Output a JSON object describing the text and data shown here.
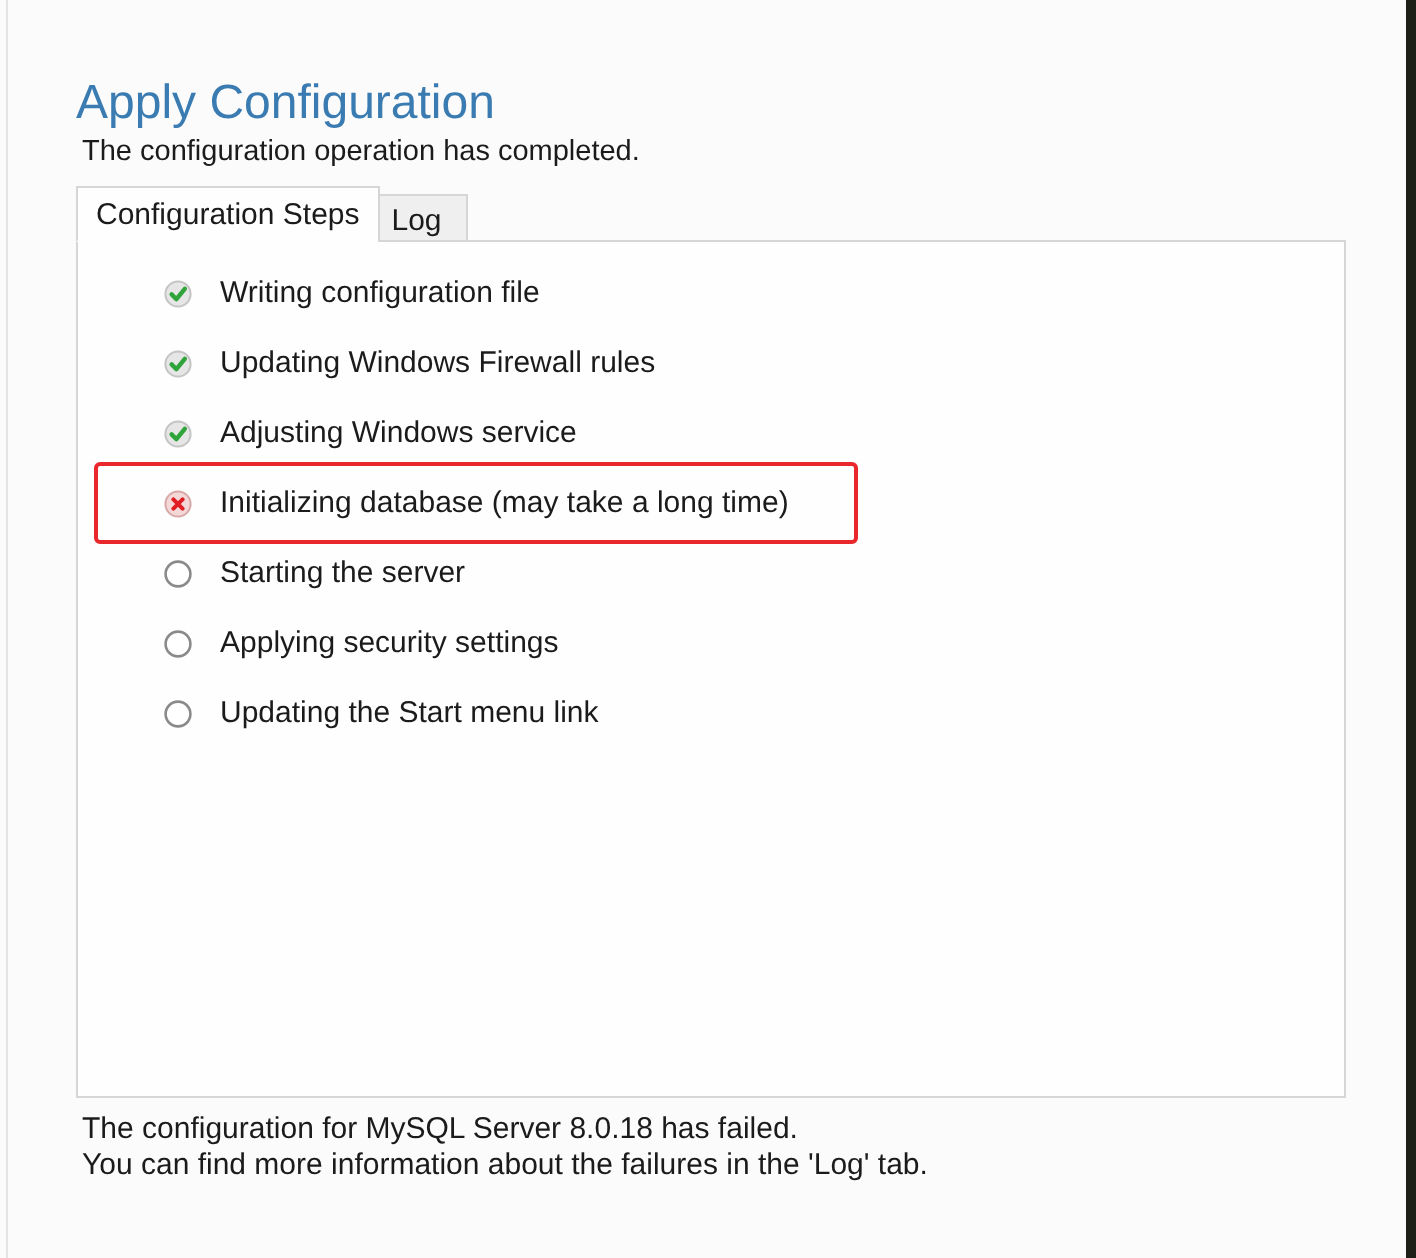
{
  "header": {
    "title": "Apply Configuration",
    "subtitle": "The configuration operation has completed."
  },
  "tabs": [
    {
      "label": "Configuration Steps",
      "selected": true
    },
    {
      "label": "Log",
      "selected": false
    }
  ],
  "steps": [
    {
      "label": "Writing configuration file",
      "kind": "done",
      "highlighted": false
    },
    {
      "label": "Updating Windows Firewall rules",
      "kind": "done",
      "highlighted": false
    },
    {
      "label": "Adjusting Windows service",
      "kind": "done",
      "highlighted": false
    },
    {
      "label": "Initializing database (may take a long time)",
      "kind": "failed",
      "highlighted": true
    },
    {
      "label": "Starting the server",
      "kind": "pending",
      "highlighted": false
    },
    {
      "label": "Applying security settings",
      "kind": "pending",
      "highlighted": false
    },
    {
      "label": "Updating the Start menu link",
      "kind": "pending",
      "highlighted": false
    }
  ],
  "footer": {
    "lines": [
      "The configuration for MySQL Server 8.0.18 has failed.",
      "You can find more information about the failures in the 'Log' tab."
    ]
  }
}
